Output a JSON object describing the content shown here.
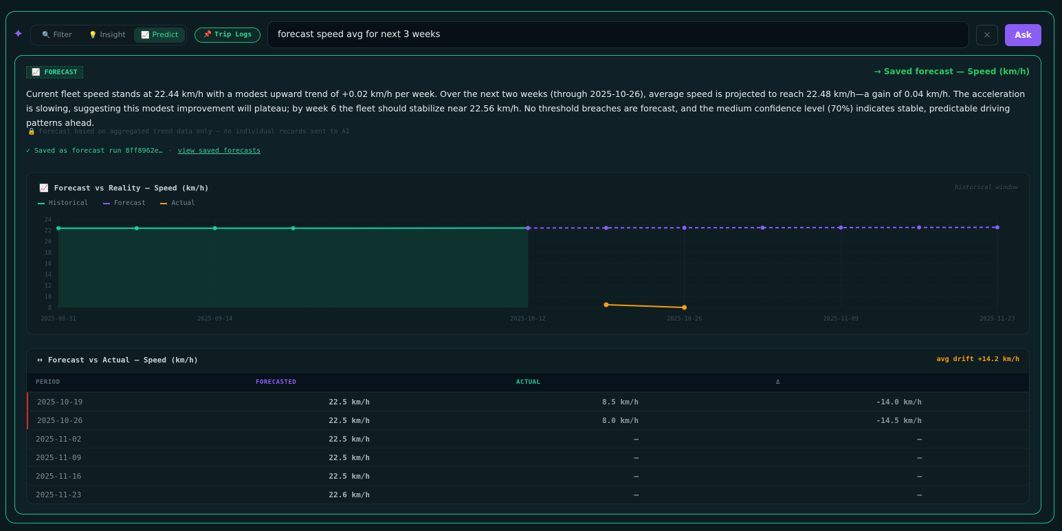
{
  "toolbar": {
    "modes": [
      {
        "label": "Filter",
        "icon": "🔍"
      },
      {
        "label": "Insight",
        "icon": "💡"
      },
      {
        "label": "Predict",
        "icon": "📈"
      }
    ],
    "trip_logs": "Trip Logs",
    "query": "forecast speed avg for next 3 weeks",
    "clear": "×",
    "ask": "Ask"
  },
  "forecast": {
    "badge": "FORECAST",
    "saved_link": "→ Saved forecast — Speed (km/h)",
    "summary": "Current fleet speed stands at 22.44 km/h with a modest upward trend of +0.02 km/h per week. Over the next two weeks (through 2025-10-26), average speed is projected to reach 22.48 km/h—a gain of 0.04 km/h. The acceleration is slowing, suggesting this modest improvement will plateau; by week 6 the fleet should stabilize near 22.56 km/h. No threshold breaches are forecast, and the medium confidence level (70%) indicates stable, predictable driving patterns ahead.",
    "privacy": "Forecast based on aggregated trend data only — no individual records sent to AI",
    "saved_run": "✓ Saved as forecast run 8ff8962e…",
    "saved_sep": "·",
    "view_saved": "view saved forecasts"
  },
  "chart": {
    "title": "Forecast vs Reality — Speed (km/h)",
    "window_label": "historical window",
    "legend": [
      "Historical",
      "Forecast",
      "Actual"
    ]
  },
  "chart_data": {
    "type": "line",
    "title": "Forecast vs Reality — Speed (km/h)",
    "x_ticks": [
      "2025-08-31",
      "2025-09-14",
      "2025-10-12",
      "2025-10-26",
      "2025-11-09",
      "2025-11-23"
    ],
    "y_ticks": [
      8,
      10,
      12,
      14,
      16,
      18,
      20,
      22,
      24
    ],
    "ylim": [
      8,
      24
    ],
    "series": [
      {
        "name": "Historical",
        "color": "#10d39a",
        "x": [
          "2025-08-31",
          "2025-09-07",
          "2025-09-14",
          "2025-09-21",
          "2025-10-12"
        ],
        "y": [
          22.4,
          22.4,
          22.4,
          22.4,
          22.44
        ]
      },
      {
        "name": "Forecast",
        "color": "#8b5cf6",
        "x": [
          "2025-10-12",
          "2025-10-19",
          "2025-10-26",
          "2025-11-02",
          "2025-11-09",
          "2025-11-16",
          "2025-11-23"
        ],
        "y": [
          22.44,
          22.46,
          22.48,
          22.5,
          22.52,
          22.54,
          22.56
        ]
      },
      {
        "name": "Actual",
        "color": "#f59e0b",
        "x": [
          "2025-10-19",
          "2025-10-26"
        ],
        "y": [
          8.5,
          8.0
        ]
      }
    ]
  },
  "table": {
    "title": "Forecast vs Actual — Speed (km/h)",
    "drift": "avg drift +14.2 km/h",
    "headers": {
      "period": "PERIOD",
      "forecasted": "FORECASTED",
      "actual": "ACTUAL",
      "delta": "Δ"
    },
    "rows": [
      {
        "period": "2025-10-19",
        "forecasted": "22.5 km/h",
        "actual": "8.5 km/h",
        "delta": "-14.0 km/h"
      },
      {
        "period": "2025-10-26",
        "forecasted": "22.5 km/h",
        "actual": "8.0 km/h",
        "delta": "-14.5 km/h"
      },
      {
        "period": "2025-11-02",
        "forecasted": "22.5 km/h",
        "actual": "—",
        "delta": "—"
      },
      {
        "period": "2025-11-09",
        "forecasted": "22.5 km/h",
        "actual": "—",
        "delta": "—"
      },
      {
        "period": "2025-11-16",
        "forecasted": "22.5 km/h",
        "actual": "—",
        "delta": "—"
      },
      {
        "period": "2025-11-23",
        "forecasted": "22.6 km/h",
        "actual": "—",
        "delta": "—"
      }
    ]
  }
}
